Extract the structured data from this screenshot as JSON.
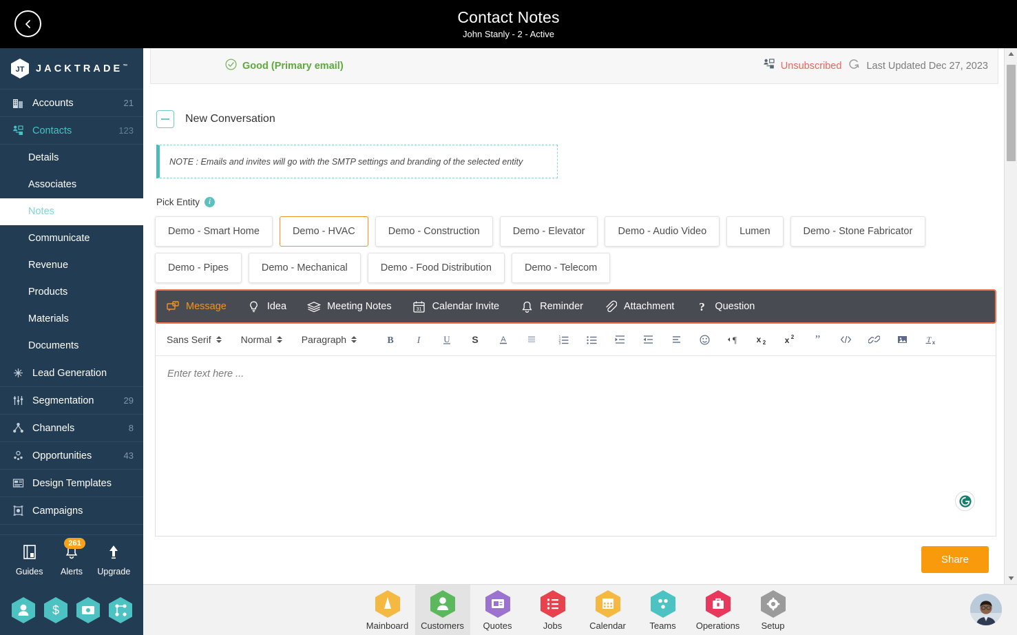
{
  "header": {
    "title": "Contact Notes",
    "subtitle": "John Stanly - 2 - Active",
    "back_icon": "chevron-left-icon"
  },
  "sidebar": {
    "brand": "JACKTRADE",
    "brand_tm": "™",
    "items": [
      {
        "label": "Accounts",
        "count": "21",
        "icon": "building-icon",
        "active": false
      },
      {
        "label": "Contacts",
        "count": "123",
        "icon": "contacts-icon",
        "active": true
      }
    ],
    "sub_items": [
      {
        "label": "Details",
        "selected": false
      },
      {
        "label": "Associates",
        "selected": false
      },
      {
        "label": "Notes",
        "selected": true
      },
      {
        "label": "Communicate",
        "selected": false
      },
      {
        "label": "Revenue",
        "selected": false
      },
      {
        "label": "Products",
        "selected": false
      },
      {
        "label": "Materials",
        "selected": false
      },
      {
        "label": "Documents",
        "selected": false
      }
    ],
    "items2": [
      {
        "label": "Lead Generation",
        "count": "",
        "icon": "lead-generation-icon"
      },
      {
        "label": "Segmentation",
        "count": "29",
        "icon": "segmentation-icon"
      },
      {
        "label": "Channels",
        "count": "8",
        "icon": "channels-icon"
      },
      {
        "label": "Opportunities",
        "count": "43",
        "icon": "opportunities-icon"
      },
      {
        "label": "Design Templates",
        "count": "",
        "icon": "design-templates-icon"
      },
      {
        "label": "Campaigns",
        "count": "",
        "icon": "campaigns-icon"
      }
    ],
    "footer": [
      {
        "label": "Guides",
        "icon": "book-icon",
        "badge": ""
      },
      {
        "label": "Alerts",
        "icon": "bell-icon",
        "badge": "261"
      },
      {
        "label": "Upgrade",
        "icon": "arrow-up-icon",
        "badge": ""
      }
    ],
    "hex_shortcuts": [
      "person-icon",
      "dollar-icon",
      "money-transfer-icon",
      "workflow-icon"
    ]
  },
  "status": {
    "email_status": "Good (Primary email)",
    "email_status_icon": "check-circle-icon",
    "unsubscribed": "Unsubscribed",
    "unsubscribed_icon": "contact-lock-icon",
    "refresh_icon": "refresh-icon",
    "last_updated": "Last Updated Dec 27, 2023"
  },
  "conversation": {
    "title": "New Conversation",
    "collapse_icon": "minus-box-icon",
    "note": "NOTE : Emails and invites will go with the SMTP settings and branding of the selected entity"
  },
  "pick_entity": {
    "label": "Pick Entity",
    "info_icon": "info-icon",
    "row1": [
      {
        "label": "Demo - Smart Home",
        "selected": false
      },
      {
        "label": "Demo - HVAC",
        "selected": true
      },
      {
        "label": "Demo - Construction",
        "selected": false
      },
      {
        "label": "Demo - Elevator",
        "selected": false
      },
      {
        "label": "Demo - Audio Video",
        "selected": false
      },
      {
        "label": "Lumen",
        "selected": false
      },
      {
        "label": "Demo - Stone Fabricator",
        "selected": false
      }
    ],
    "row2": [
      {
        "label": "Demo - Pipes",
        "selected": false
      },
      {
        "label": "Demo - Mechanical",
        "selected": false
      },
      {
        "label": "Demo - Food Distribution",
        "selected": false
      },
      {
        "label": "Demo - Telecom",
        "selected": false
      }
    ]
  },
  "type_tabs": [
    {
      "label": "Message",
      "icon": "message-icon",
      "active": true
    },
    {
      "label": "Idea",
      "icon": "lightbulb-icon",
      "active": false
    },
    {
      "label": "Meeting Notes",
      "icon": "layers-icon",
      "active": false
    },
    {
      "label": "Calendar Invite",
      "icon": "calendar-31-icon",
      "active": false
    },
    {
      "label": "Reminder",
      "icon": "bell-icon",
      "active": false
    },
    {
      "label": "Attachment",
      "icon": "paperclip-icon",
      "active": false
    },
    {
      "label": "Question",
      "icon": "question-mark-icon",
      "active": false
    }
  ],
  "editor": {
    "font_family": "Sans Serif",
    "font_size": "Normal",
    "block_format": "Paragraph",
    "placeholder": "Enter text here ...",
    "grammarly_icon": "grammarly-icon",
    "tools": [
      {
        "name": "bold-button",
        "glyph": "B"
      },
      {
        "name": "italic-button",
        "glyph": "I"
      },
      {
        "name": "underline-button",
        "glyph": "U"
      },
      {
        "name": "strikethrough-button",
        "glyph": "S"
      },
      {
        "name": "text-color-button",
        "glyph": "A"
      },
      {
        "name": "background-color-button",
        "glyph": "▨"
      },
      {
        "name": "ordered-list-button",
        "glyph": "1."
      },
      {
        "name": "bullet-list-button",
        "glyph": "•"
      },
      {
        "name": "outdent-button",
        "glyph": "⇤"
      },
      {
        "name": "indent-button",
        "glyph": "⇥"
      },
      {
        "name": "align-button",
        "glyph": "≡"
      },
      {
        "name": "emoji-button",
        "glyph": "☺"
      },
      {
        "name": "text-direction-button",
        "glyph": "¶"
      },
      {
        "name": "subscript-button",
        "glyph": "x₂"
      },
      {
        "name": "superscript-button",
        "glyph": "x²"
      },
      {
        "name": "blockquote-button",
        "glyph": "”"
      },
      {
        "name": "code-block-button",
        "glyph": "</>"
      },
      {
        "name": "link-button",
        "glyph": "🔗"
      },
      {
        "name": "image-button",
        "glyph": "🖼"
      },
      {
        "name": "clear-format-button",
        "glyph": "Tx"
      }
    ]
  },
  "actions": {
    "share_label": "Share"
  },
  "bottom_nav": [
    {
      "label": "Mainboard",
      "color": "#f5b942",
      "icon": "sail-icon",
      "active": false
    },
    {
      "label": "Customers",
      "color": "#5cb85c",
      "icon": "person-icon",
      "active": true
    },
    {
      "label": "Quotes",
      "color": "#9b72cf",
      "icon": "quote-cards-icon",
      "active": false
    },
    {
      "label": "Jobs",
      "color": "#e8424f",
      "icon": "list-icon",
      "active": false
    },
    {
      "label": "Calendar",
      "color": "#f5b942",
      "icon": "calendar-icon",
      "active": false
    },
    {
      "label": "Teams",
      "color": "#4cc2c2",
      "icon": "teams-icon",
      "active": false
    },
    {
      "label": "Operations",
      "color": "#e8395c",
      "icon": "briefcase-icon",
      "active": false
    },
    {
      "label": "Setup",
      "color": "#9b9b9b",
      "icon": "gear-icon",
      "active": false
    }
  ],
  "avatar": {
    "name": "user-avatar"
  },
  "colors": {
    "sidebar_bg": "#223c54",
    "accent_teal": "#4bbcbc",
    "accent_orange": "#f0951e",
    "highlight_orange": "#f2714a",
    "share_orange": "#f99a0c",
    "good_green": "#5faa3c",
    "unsub_red": "#f0635a"
  }
}
